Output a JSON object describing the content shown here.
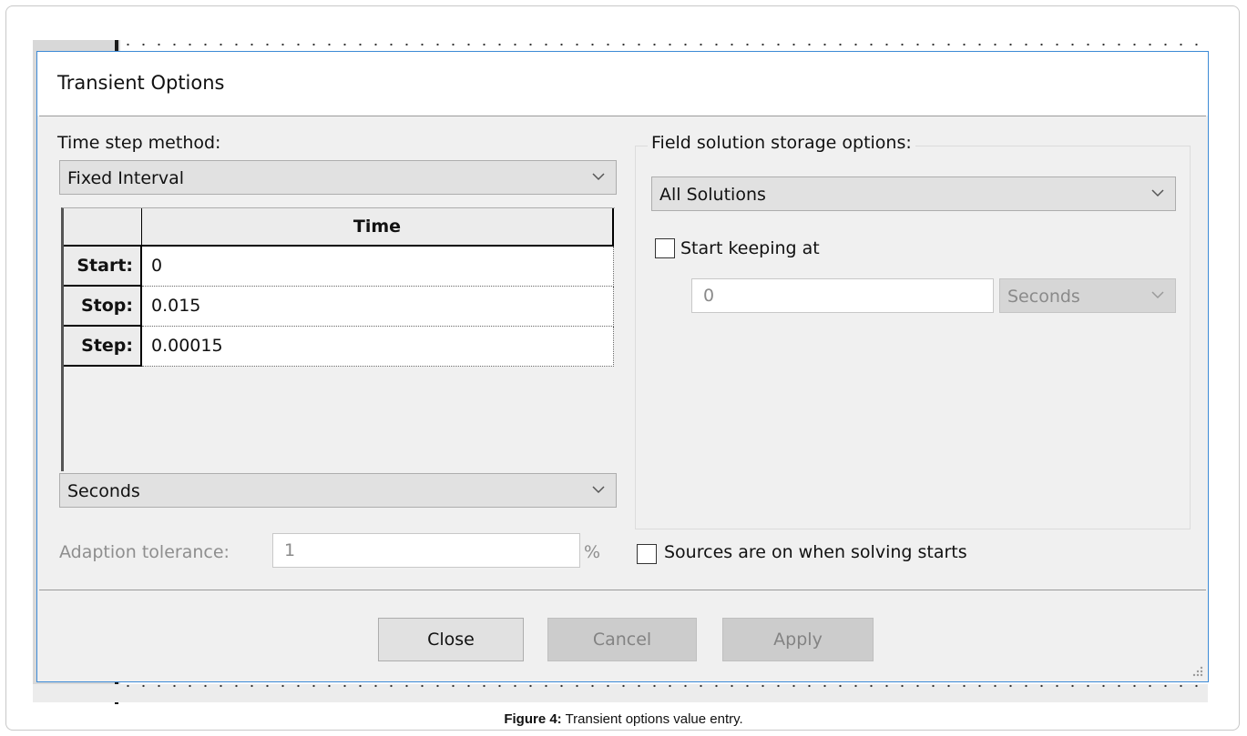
{
  "dialog": {
    "title": "Transient Options",
    "time_step_method": {
      "label": "Time step method:",
      "selected": "Fixed Interval"
    },
    "time_table": {
      "column_header": "Time",
      "rows": [
        {
          "label": "Start:",
          "value": "0"
        },
        {
          "label": "Stop:",
          "value": "0.015"
        },
        {
          "label": "Step:",
          "value": "0.00015"
        }
      ]
    },
    "time_units": {
      "selected": "Seconds"
    },
    "adaption_tolerance": {
      "label": "Adaption tolerance:",
      "value": "1",
      "unit": "%"
    },
    "field_storage": {
      "label": "Field solution storage options:",
      "selected": "All Solutions",
      "start_keeping_label": "Start keeping at",
      "start_keeping_checked": false,
      "start_keeping_value": "0",
      "start_keeping_units": "Seconds"
    },
    "sources_on_label": "Sources are on when solving starts",
    "sources_on_checked": false,
    "buttons": {
      "close": "Close",
      "cancel": "Cancel",
      "apply": "Apply"
    }
  },
  "caption": {
    "prefix": "Figure 4:",
    "text": " Transient options value entry."
  },
  "colors": {
    "dialog_border": "#3c8ad6",
    "client_bg": "#f0f0f0",
    "disabled_text": "#8e8e8e"
  }
}
